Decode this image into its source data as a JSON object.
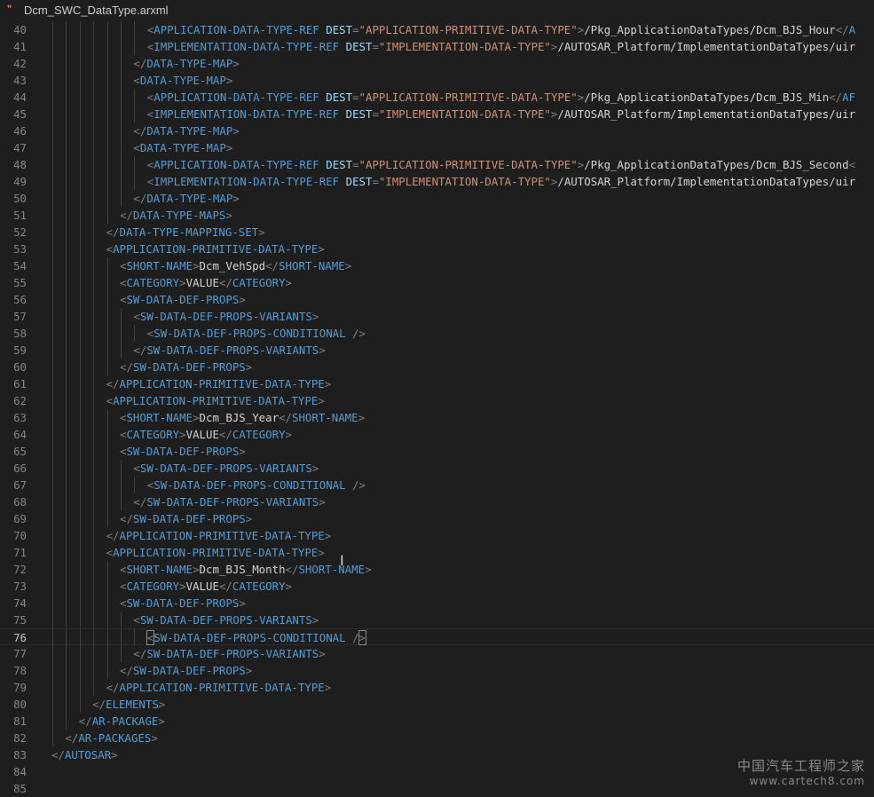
{
  "tab": {
    "filename": "Dcm_SWC_DataType.arxml",
    "icon": "rss-icon"
  },
  "editor": {
    "active_line": "76",
    "lines": [
      {
        "n": "40",
        "indent": 7,
        "tokens": [
          [
            "p",
            "<"
          ],
          [
            "tag",
            "APPLICATION-DATA-TYPE-REF"
          ],
          [
            "sp",
            " "
          ],
          [
            "attr",
            "DEST"
          ],
          [
            "p",
            "="
          ],
          [
            "str",
            "\"APPLICATION-PRIMITIVE-DATA-TYPE\""
          ],
          [
            "p",
            ">"
          ],
          [
            "text",
            "/Pkg_ApplicationDataTypes/Dcm_BJS_Hour"
          ],
          [
            "p",
            "</"
          ],
          [
            "tag",
            "A"
          ]
        ]
      },
      {
        "n": "41",
        "indent": 7,
        "tokens": [
          [
            "p",
            "<"
          ],
          [
            "tag",
            "IMPLEMENTATION-DATA-TYPE-REF"
          ],
          [
            "sp",
            " "
          ],
          [
            "attr",
            "DEST"
          ],
          [
            "p",
            "="
          ],
          [
            "str",
            "\"IMPLEMENTATION-DATA-TYPE\""
          ],
          [
            "p",
            ">"
          ],
          [
            "text",
            "/AUTOSAR_Platform/ImplementationDataTypes/uir"
          ]
        ]
      },
      {
        "n": "42",
        "indent": 6,
        "tokens": [
          [
            "p",
            "</"
          ],
          [
            "tag",
            "DATA-TYPE-MAP"
          ],
          [
            "p",
            ">"
          ]
        ]
      },
      {
        "n": "43",
        "indent": 6,
        "tokens": [
          [
            "p",
            "<"
          ],
          [
            "tag",
            "DATA-TYPE-MAP"
          ],
          [
            "p",
            ">"
          ]
        ]
      },
      {
        "n": "44",
        "indent": 7,
        "tokens": [
          [
            "p",
            "<"
          ],
          [
            "tag",
            "APPLICATION-DATA-TYPE-REF"
          ],
          [
            "sp",
            " "
          ],
          [
            "attr",
            "DEST"
          ],
          [
            "p",
            "="
          ],
          [
            "str",
            "\"APPLICATION-PRIMITIVE-DATA-TYPE\""
          ],
          [
            "p",
            ">"
          ],
          [
            "text",
            "/Pkg_ApplicationDataTypes/Dcm_BJS_Min"
          ],
          [
            "p",
            "</"
          ],
          [
            "tag",
            "AF"
          ]
        ]
      },
      {
        "n": "45",
        "indent": 7,
        "tokens": [
          [
            "p",
            "<"
          ],
          [
            "tag",
            "IMPLEMENTATION-DATA-TYPE-REF"
          ],
          [
            "sp",
            " "
          ],
          [
            "attr",
            "DEST"
          ],
          [
            "p",
            "="
          ],
          [
            "str",
            "\"IMPLEMENTATION-DATA-TYPE\""
          ],
          [
            "p",
            ">"
          ],
          [
            "text",
            "/AUTOSAR_Platform/ImplementationDataTypes/uir"
          ]
        ]
      },
      {
        "n": "46",
        "indent": 6,
        "tokens": [
          [
            "p",
            "</"
          ],
          [
            "tag",
            "DATA-TYPE-MAP"
          ],
          [
            "p",
            ">"
          ]
        ]
      },
      {
        "n": "47",
        "indent": 6,
        "tokens": [
          [
            "p",
            "<"
          ],
          [
            "tag",
            "DATA-TYPE-MAP"
          ],
          [
            "p",
            ">"
          ]
        ]
      },
      {
        "n": "48",
        "indent": 7,
        "tokens": [
          [
            "p",
            "<"
          ],
          [
            "tag",
            "APPLICATION-DATA-TYPE-REF"
          ],
          [
            "sp",
            " "
          ],
          [
            "attr",
            "DEST"
          ],
          [
            "p",
            "="
          ],
          [
            "str",
            "\"APPLICATION-PRIMITIVE-DATA-TYPE\""
          ],
          [
            "p",
            ">"
          ],
          [
            "text",
            "/Pkg_ApplicationDataTypes/Dcm_BJS_Second"
          ],
          [
            "p",
            "<"
          ]
        ]
      },
      {
        "n": "49",
        "indent": 7,
        "tokens": [
          [
            "p",
            "<"
          ],
          [
            "tag",
            "IMPLEMENTATION-DATA-TYPE-REF"
          ],
          [
            "sp",
            " "
          ],
          [
            "attr",
            "DEST"
          ],
          [
            "p",
            "="
          ],
          [
            "str",
            "\"IMPLEMENTATION-DATA-TYPE\""
          ],
          [
            "p",
            ">"
          ],
          [
            "text",
            "/AUTOSAR_Platform/ImplementationDataTypes/uir"
          ]
        ]
      },
      {
        "n": "50",
        "indent": 6,
        "tokens": [
          [
            "p",
            "</"
          ],
          [
            "tag",
            "DATA-TYPE-MAP"
          ],
          [
            "p",
            ">"
          ]
        ]
      },
      {
        "n": "51",
        "indent": 5,
        "tokens": [
          [
            "p",
            "</"
          ],
          [
            "tag",
            "DATA-TYPE-MAPS"
          ],
          [
            "p",
            ">"
          ]
        ]
      },
      {
        "n": "52",
        "indent": 4,
        "tokens": [
          [
            "p",
            "</"
          ],
          [
            "tag",
            "DATA-TYPE-MAPPING-SET"
          ],
          [
            "p",
            ">"
          ]
        ]
      },
      {
        "n": "53",
        "indent": 4,
        "tokens": [
          [
            "p",
            "<"
          ],
          [
            "tag",
            "APPLICATION-PRIMITIVE-DATA-TYPE"
          ],
          [
            "p",
            ">"
          ]
        ]
      },
      {
        "n": "54",
        "indent": 5,
        "tokens": [
          [
            "p",
            "<"
          ],
          [
            "tag",
            "SHORT-NAME"
          ],
          [
            "p",
            ">"
          ],
          [
            "text",
            "Dcm_VehSpd"
          ],
          [
            "p",
            "</"
          ],
          [
            "tag",
            "SHORT-NAME"
          ],
          [
            "p",
            ">"
          ]
        ]
      },
      {
        "n": "55",
        "indent": 5,
        "tokens": [
          [
            "p",
            "<"
          ],
          [
            "tag",
            "CATEGORY"
          ],
          [
            "p",
            ">"
          ],
          [
            "text",
            "VALUE"
          ],
          [
            "p",
            "</"
          ],
          [
            "tag",
            "CATEGORY"
          ],
          [
            "p",
            ">"
          ]
        ]
      },
      {
        "n": "56",
        "indent": 5,
        "tokens": [
          [
            "p",
            "<"
          ],
          [
            "tag",
            "SW-DATA-DEF-PROPS"
          ],
          [
            "p",
            ">"
          ]
        ]
      },
      {
        "n": "57",
        "indent": 6,
        "tokens": [
          [
            "p",
            "<"
          ],
          [
            "tag",
            "SW-DATA-DEF-PROPS-VARIANTS"
          ],
          [
            "p",
            ">"
          ]
        ]
      },
      {
        "n": "58",
        "indent": 7,
        "tokens": [
          [
            "p",
            "<"
          ],
          [
            "tag",
            "SW-DATA-DEF-PROPS-CONDITIONAL"
          ],
          [
            "sp",
            " "
          ],
          [
            "p",
            "/>"
          ]
        ]
      },
      {
        "n": "59",
        "indent": 6,
        "tokens": [
          [
            "p",
            "</"
          ],
          [
            "tag",
            "SW-DATA-DEF-PROPS-VARIANTS"
          ],
          [
            "p",
            ">"
          ]
        ]
      },
      {
        "n": "60",
        "indent": 5,
        "tokens": [
          [
            "p",
            "</"
          ],
          [
            "tag",
            "SW-DATA-DEF-PROPS"
          ],
          [
            "p",
            ">"
          ]
        ]
      },
      {
        "n": "61",
        "indent": 4,
        "tokens": [
          [
            "p",
            "</"
          ],
          [
            "tag",
            "APPLICATION-PRIMITIVE-DATA-TYPE"
          ],
          [
            "p",
            ">"
          ]
        ]
      },
      {
        "n": "62",
        "indent": 4,
        "tokens": [
          [
            "p",
            "<"
          ],
          [
            "tag",
            "APPLICATION-PRIMITIVE-DATA-TYPE"
          ],
          [
            "p",
            ">"
          ]
        ]
      },
      {
        "n": "63",
        "indent": 5,
        "tokens": [
          [
            "p",
            "<"
          ],
          [
            "tag",
            "SHORT-NAME"
          ],
          [
            "p",
            ">"
          ],
          [
            "text",
            "Dcm_BJS_Year"
          ],
          [
            "p",
            "</"
          ],
          [
            "tag",
            "SHORT-NAME"
          ],
          [
            "p",
            ">"
          ]
        ]
      },
      {
        "n": "64",
        "indent": 5,
        "tokens": [
          [
            "p",
            "<"
          ],
          [
            "tag",
            "CATEGORY"
          ],
          [
            "p",
            ">"
          ],
          [
            "text",
            "VALUE"
          ],
          [
            "p",
            "</"
          ],
          [
            "tag",
            "CATEGORY"
          ],
          [
            "p",
            ">"
          ]
        ]
      },
      {
        "n": "65",
        "indent": 5,
        "tokens": [
          [
            "p",
            "<"
          ],
          [
            "tag",
            "SW-DATA-DEF-PROPS"
          ],
          [
            "p",
            ">"
          ]
        ]
      },
      {
        "n": "66",
        "indent": 6,
        "tokens": [
          [
            "p",
            "<"
          ],
          [
            "tag",
            "SW-DATA-DEF-PROPS-VARIANTS"
          ],
          [
            "p",
            ">"
          ]
        ]
      },
      {
        "n": "67",
        "indent": 7,
        "tokens": [
          [
            "p",
            "<"
          ],
          [
            "tag",
            "SW-DATA-DEF-PROPS-CONDITIONAL"
          ],
          [
            "sp",
            " "
          ],
          [
            "p",
            "/>"
          ]
        ]
      },
      {
        "n": "68",
        "indent": 6,
        "tokens": [
          [
            "p",
            "</"
          ],
          [
            "tag",
            "SW-DATA-DEF-PROPS-VARIANTS"
          ],
          [
            "p",
            ">"
          ]
        ]
      },
      {
        "n": "69",
        "indent": 5,
        "tokens": [
          [
            "p",
            "</"
          ],
          [
            "tag",
            "SW-DATA-DEF-PROPS"
          ],
          [
            "p",
            ">"
          ]
        ]
      },
      {
        "n": "70",
        "indent": 4,
        "tokens": [
          [
            "p",
            "</"
          ],
          [
            "tag",
            "APPLICATION-PRIMITIVE-DATA-TYPE"
          ],
          [
            "p",
            ">"
          ]
        ]
      },
      {
        "n": "71",
        "indent": 4,
        "tokens": [
          [
            "p",
            "<"
          ],
          [
            "tag",
            "APPLICATION-PRIMITIVE-DATA-TYPE"
          ],
          [
            "p",
            ">"
          ]
        ]
      },
      {
        "n": "72",
        "indent": 5,
        "tokens": [
          [
            "p",
            "<"
          ],
          [
            "tag",
            "SHORT-NAME"
          ],
          [
            "p",
            ">"
          ],
          [
            "text",
            "Dcm_BJS_Month"
          ],
          [
            "p",
            "</"
          ],
          [
            "tag",
            "SHORT-NAME"
          ],
          [
            "p",
            ">"
          ]
        ]
      },
      {
        "n": "73",
        "indent": 5,
        "tokens": [
          [
            "p",
            "<"
          ],
          [
            "tag",
            "CATEGORY"
          ],
          [
            "p",
            ">"
          ],
          [
            "text",
            "VALUE"
          ],
          [
            "p",
            "</"
          ],
          [
            "tag",
            "CATEGORY"
          ],
          [
            "p",
            ">"
          ]
        ]
      },
      {
        "n": "74",
        "indent": 5,
        "tokens": [
          [
            "p",
            "<"
          ],
          [
            "tag",
            "SW-DATA-DEF-PROPS"
          ],
          [
            "p",
            ">"
          ]
        ]
      },
      {
        "n": "75",
        "indent": 6,
        "tokens": [
          [
            "p",
            "<"
          ],
          [
            "tag",
            "SW-DATA-DEF-PROPS-VARIANTS"
          ],
          [
            "p",
            ">"
          ]
        ]
      },
      {
        "n": "76",
        "indent": 7,
        "tokens": [
          [
            "pb",
            "<"
          ],
          [
            "tag",
            "SW-DATA-DEF-PROPS-CONDITIONAL"
          ],
          [
            "sp",
            " "
          ],
          [
            "p",
            "/"
          ],
          [
            "pb",
            ">"
          ]
        ]
      },
      {
        "n": "77",
        "indent": 6,
        "tokens": [
          [
            "p",
            "</"
          ],
          [
            "tag",
            "SW-DATA-DEF-PROPS-VARIANTS"
          ],
          [
            "p",
            ">"
          ]
        ]
      },
      {
        "n": "78",
        "indent": 5,
        "tokens": [
          [
            "p",
            "</"
          ],
          [
            "tag",
            "SW-DATA-DEF-PROPS"
          ],
          [
            "p",
            ">"
          ]
        ]
      },
      {
        "n": "79",
        "indent": 4,
        "tokens": [
          [
            "p",
            "</"
          ],
          [
            "tag",
            "APPLICATION-PRIMITIVE-DATA-TYPE"
          ],
          [
            "p",
            ">"
          ]
        ]
      },
      {
        "n": "80",
        "indent": 3,
        "tokens": [
          [
            "p",
            "</"
          ],
          [
            "tag",
            "ELEMENTS"
          ],
          [
            "p",
            ">"
          ]
        ]
      },
      {
        "n": "81",
        "indent": 2,
        "tokens": [
          [
            "p",
            "</"
          ],
          [
            "tag",
            "AR-PACKAGE"
          ],
          [
            "p",
            ">"
          ]
        ]
      },
      {
        "n": "82",
        "indent": 1,
        "tokens": [
          [
            "p",
            "</"
          ],
          [
            "tag",
            "AR-PACKAGES"
          ],
          [
            "p",
            ">"
          ]
        ]
      },
      {
        "n": "83",
        "indent": 0,
        "tokens": [
          [
            "p",
            "</"
          ],
          [
            "tag",
            "AUTOSAR"
          ],
          [
            "p",
            ">"
          ]
        ]
      },
      {
        "n": "84",
        "indent": 0,
        "tokens": []
      },
      {
        "n": "85",
        "indent": 0,
        "tokens": []
      }
    ]
  },
  "watermark": {
    "cn": "中国汽车工程师之家",
    "url": "www.cartech8.com"
  }
}
